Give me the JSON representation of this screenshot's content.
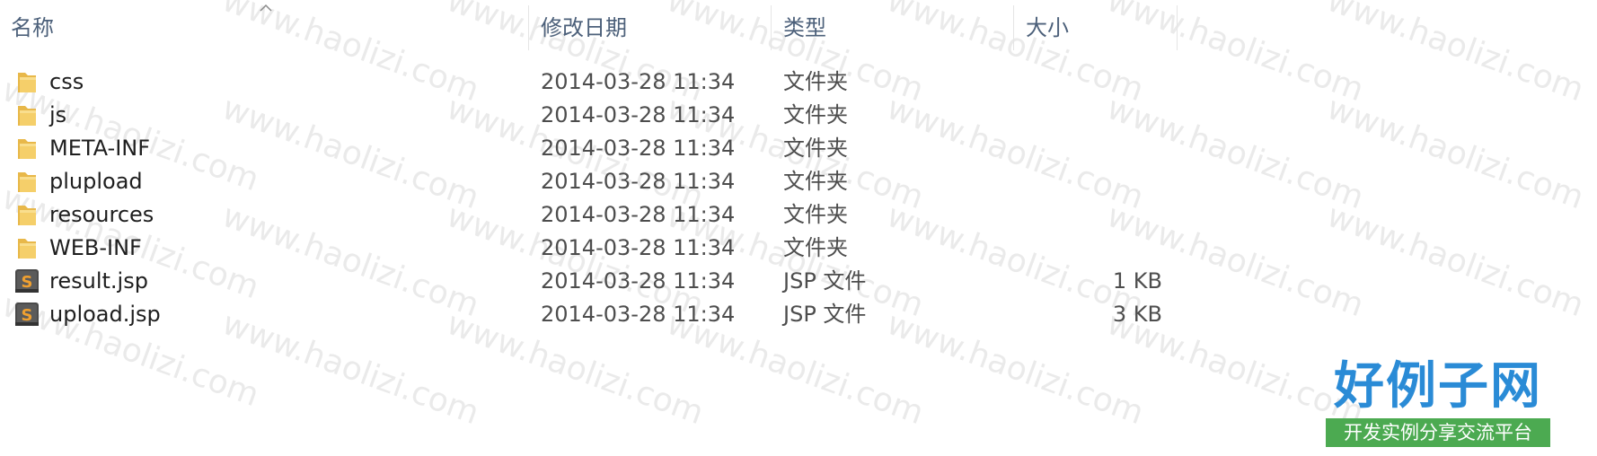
{
  "columns": {
    "name": "名称",
    "modified": "修改日期",
    "type": "类型",
    "size": "大小"
  },
  "files": [
    {
      "name": "css",
      "modified": "2014-03-28 11:34",
      "type": "文件夹",
      "size": "",
      "icon": "folder-icon"
    },
    {
      "name": "js",
      "modified": "2014-03-28 11:34",
      "type": "文件夹",
      "size": "",
      "icon": "folder-icon"
    },
    {
      "name": "META-INF",
      "modified": "2014-03-28 11:34",
      "type": "文件夹",
      "size": "",
      "icon": "folder-icon"
    },
    {
      "name": "plupload",
      "modified": "2014-03-28 11:34",
      "type": "文件夹",
      "size": "",
      "icon": "folder-icon"
    },
    {
      "name": "resources",
      "modified": "2014-03-28 11:34",
      "type": "文件夹",
      "size": "",
      "icon": "folder-icon"
    },
    {
      "name": "WEB-INF",
      "modified": "2014-03-28 11:34",
      "type": "文件夹",
      "size": "",
      "icon": "folder-icon"
    },
    {
      "name": "result.jsp",
      "modified": "2014-03-28 11:34",
      "type": "JSP 文件",
      "size": "1 KB",
      "icon": "jsp-file-icon"
    },
    {
      "name": "upload.jsp",
      "modified": "2014-03-28 11:34",
      "type": "JSP 文件",
      "size": "3 KB",
      "icon": "jsp-file-icon"
    }
  ],
  "watermark": {
    "text": "www.haolizi.com"
  },
  "logo": {
    "title": "好例子网",
    "subtitle": "开发实例分享交流平台"
  },
  "colors": {
    "header_text": "#4c607a",
    "folder": "#f2c55c",
    "logo_blue": "#2a8bd6",
    "logo_green": "#4caa51"
  }
}
